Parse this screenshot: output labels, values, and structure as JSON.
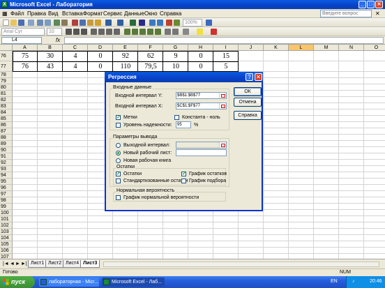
{
  "window": {
    "title": "Microsoft Excel - Лаборатория"
  },
  "menu": {
    "items": [
      "Файл",
      "Правка",
      "Вид",
      "Вставка",
      "Формат",
      "Сервис",
      "Данные",
      "Окно",
      "Справка"
    ],
    "help_placeholder": "Введите вопрос"
  },
  "toolbar": {
    "zoom": "100%",
    "font": "Arial Cyr",
    "size": "10"
  },
  "formula_bar": {
    "name_box": "L4",
    "fx": "fx"
  },
  "grid": {
    "columns": [
      "A",
      "B",
      "C",
      "D",
      "E",
      "F",
      "G",
      "H",
      "I",
      "J",
      "K",
      "L",
      "M",
      "N",
      "O"
    ],
    "active_column": "L",
    "rows": [
      "76",
      "77",
      "78",
      "79",
      "80",
      "81",
      "82",
      "83",
      "84",
      "85",
      "86",
      "87",
      "88",
      "89",
      "90",
      "91",
      "92",
      "93",
      "94",
      "95",
      "96",
      "97",
      "98",
      "99",
      "100",
      "101",
      "102",
      "103",
      "104",
      "105",
      "106",
      "107",
      "108"
    ],
    "data_rows": [
      [
        "75",
        "30",
        "4",
        "0",
        "92",
        "62",
        "9",
        "0",
        "15"
      ],
      [
        "76",
        "43",
        "4",
        "0",
        "110",
        "79,5",
        "10",
        "0",
        "5"
      ]
    ]
  },
  "sheet_tabs": [
    "Лист1",
    "Лист2",
    "Лист4",
    "Лист3"
  ],
  "active_sheet": "Лист3",
  "status": {
    "ready": "Готово",
    "num": "NUM"
  },
  "taskbar": {
    "start": "пуск",
    "items": [
      "лабораторная - Micr...",
      "Microsoft Excel - Лаб..."
    ],
    "lang": "EN",
    "time": "20:46"
  },
  "dialog": {
    "title": "Регрессия",
    "help_glyph": "?",
    "close_glyph": "✕",
    "input_group": "Входные данные",
    "input_y_label": "Входной интервал Y:",
    "input_y_value": "$B$1:$B$77",
    "input_x_label": "Входной интервал X:",
    "input_x_value": "$C$1:$F$77",
    "labels_check": "Метки",
    "labels_checked": true,
    "const_zero": "Константа - ноль",
    "confidence_label": "Уровень надежности:",
    "confidence_value": "95",
    "percent": "%",
    "output_group": "Параметры вывода",
    "output_range": "Выходной интервал:",
    "new_sheet": "Новый рабочий лист:",
    "new_book": "Новая рабочая книга",
    "residuals_group": "Остатки",
    "residuals": "Остатки",
    "std_residuals": "Стандартизованные остатки",
    "residual_plot": "График остатков",
    "fit_plot": "График подбора",
    "normal_group": "Нормальная вероятность",
    "normal_plot": "График нормальной вероятности",
    "ok": "ОК",
    "cancel": "Отмена",
    "help": "Справка"
  }
}
